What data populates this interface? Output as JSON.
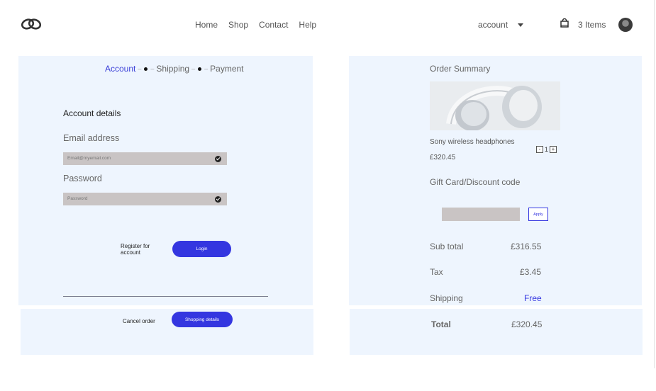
{
  "header": {
    "logo_icon": "interlocking-rings-logo",
    "nav": [
      "Home",
      "Shop",
      "Contact",
      "Help"
    ],
    "account_label": "account",
    "bag_icon": "shopping-bag-icon",
    "items_label": "3 Items"
  },
  "checkout": {
    "steps": [
      "Account",
      "Shipping",
      "Payment"
    ],
    "active_step": "Account",
    "section_title": "Account details",
    "email_label": "Email address",
    "email_placeholder": "Email@myemail.com",
    "password_label": "Password",
    "password_placeholder": "Password",
    "register_line1": "Register for",
    "register_line2": "account",
    "login_button": "Login",
    "cancel_label": "Cancel order",
    "shipping_button": "Shopping details"
  },
  "summary": {
    "title": "Order Summary",
    "product_name": "Sony wireless headphones",
    "product_price": "£320.45",
    "quantity": "1",
    "minus": "-",
    "plus": "+",
    "gift_label": "Gift Card/Discount code",
    "apply_button": "Apply",
    "subtotal_label": "Sub total",
    "subtotal_value": "£316.55",
    "tax_label": "Tax",
    "tax_value": "£3.45",
    "shipping_label": "Shipping",
    "shipping_value": "Free",
    "total_label": "Total",
    "total_value": "£320.45"
  },
  "colors": {
    "accent": "#3436e0",
    "panel_bg": "#eef5fe",
    "input_bg": "#c9c4c4"
  }
}
